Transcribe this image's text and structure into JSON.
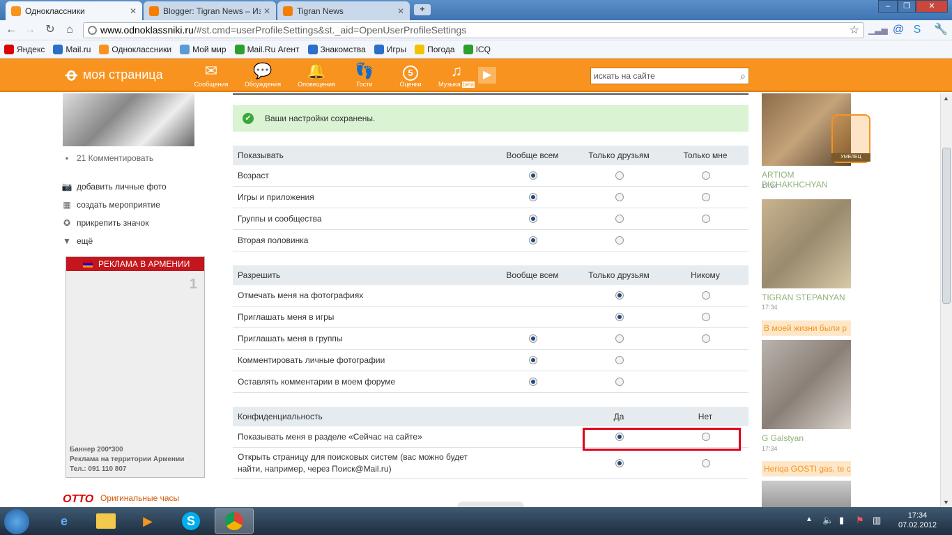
{
  "browser": {
    "tabs": [
      {
        "title": "Одноклассники"
      },
      {
        "title": "Blogger: Tigran News – Изм"
      },
      {
        "title": "Tigran News"
      }
    ],
    "url_host": "www.odnoklassniki.ru",
    "url_path": "/#st.cmd=userProfileSettings&st._aid=OpenUserProfileSettings"
  },
  "bookmarks": [
    {
      "label": "Яндекс",
      "color": "#d00"
    },
    {
      "label": "Mail.ru",
      "color": "#2a6fc9"
    },
    {
      "label": "Одноклассники",
      "color": "#f7931e"
    },
    {
      "label": "Мой мир",
      "color": "#5b9bd5"
    },
    {
      "label": "Mail.Ru Агент",
      "color": "#2ca02c"
    },
    {
      "label": "Знакомства",
      "color": "#2a6fc9"
    },
    {
      "label": "Игры",
      "color": "#2a6fc9"
    },
    {
      "label": "Погода",
      "color": "#f2c200"
    },
    {
      "label": "ICQ",
      "color": "#2ca02c"
    }
  ],
  "site": {
    "logo_text": "моя страница",
    "nav": [
      {
        "label": "Сообщения",
        "icon": "envelope-icon"
      },
      {
        "label": "Обсуждения",
        "icon": "chat-icon"
      },
      {
        "label": "Оповещения",
        "icon": "bell-icon"
      },
      {
        "label": "Гости",
        "icon": "footprints-icon"
      },
      {
        "label": "Оценки",
        "icon": "rating-icon",
        "badge": "5"
      },
      {
        "label": "Музыка",
        "icon": "music-icon",
        "badge": "beta"
      }
    ],
    "search_placeholder": "искать на сайте"
  },
  "left": {
    "comments": "21 Комментировать",
    "links": [
      "добавить личные фото",
      "создать мероприятие",
      "прикрепить значок",
      "ещё"
    ],
    "ad_title": "РЕКЛАМА В АРМЕНИИ",
    "ad_number": "1",
    "ad_lines": [
      "Баннер 200*300",
      "Реклама на территории Армении",
      "Тел.: 091 110 807"
    ],
    "otto_logo": "OTTO",
    "otto_text": "Оригинальные часы"
  },
  "settings": {
    "saved_message": "Ваши настройки сохранены.",
    "show": {
      "title": "Показывать",
      "cols": [
        "Вообще всем",
        "Только друзьям",
        "Только мне"
      ],
      "rows": [
        {
          "label": "Возраст",
          "selected": 0,
          "options": 3
        },
        {
          "label": "Игры и приложения",
          "selected": 0,
          "options": 3
        },
        {
          "label": "Группы и сообщества",
          "selected": 0,
          "options": 3
        },
        {
          "label": "Вторая половинка",
          "selected": 0,
          "options": 2
        }
      ]
    },
    "allow": {
      "title": "Разрешить",
      "cols": [
        "Вообще всем",
        "Только друзьям",
        "Никому"
      ],
      "rows": [
        {
          "label": "Отмечать меня на фотографиях",
          "selected": 1,
          "first": 1
        },
        {
          "label": "Приглашать меня в игры",
          "selected": 1,
          "first": 1
        },
        {
          "label": "Приглашать меня в группы",
          "selected": 0,
          "first": 0
        },
        {
          "label": "Комментировать личные фотографии",
          "selected": 0,
          "first": 0,
          "last": 1
        },
        {
          "label": "Оставлять комментарии в моем форуме",
          "selected": 0,
          "first": 0,
          "last": 1
        }
      ]
    },
    "privacy": {
      "title": "Конфиденциальность",
      "cols": [
        "Да",
        "Нет"
      ],
      "rows": [
        {
          "label": "Показывать меня в разделе «Сейчас на сайте»",
          "selected": 0
        },
        {
          "label": "Открыть страницу для поисковых систем (вас можно будет найти, например, через Поиск@Mail.ru)",
          "selected": 0
        }
      ]
    }
  },
  "right": {
    "badge": "УМЕЛЕЦ",
    "users": [
      {
        "name": "ARTIOM BICHAKHCHYAN",
        "time": "17:34"
      },
      {
        "name": "TIGRAN STEPANYAN",
        "time": "17:34"
      },
      {
        "name": "G Galstyan",
        "time": "17:34",
        "caption": "В моей жизни были р"
      },
      {
        "caption": "Heriqa GOSTI gas, te c"
      }
    ]
  },
  "taskbar": {
    "time": "17:34",
    "date": "07.02.2012"
  },
  "colors": {
    "brand_orange": "#f7931e",
    "highlight_red": "#e0001b",
    "saved_green": "#d9f3d3"
  }
}
